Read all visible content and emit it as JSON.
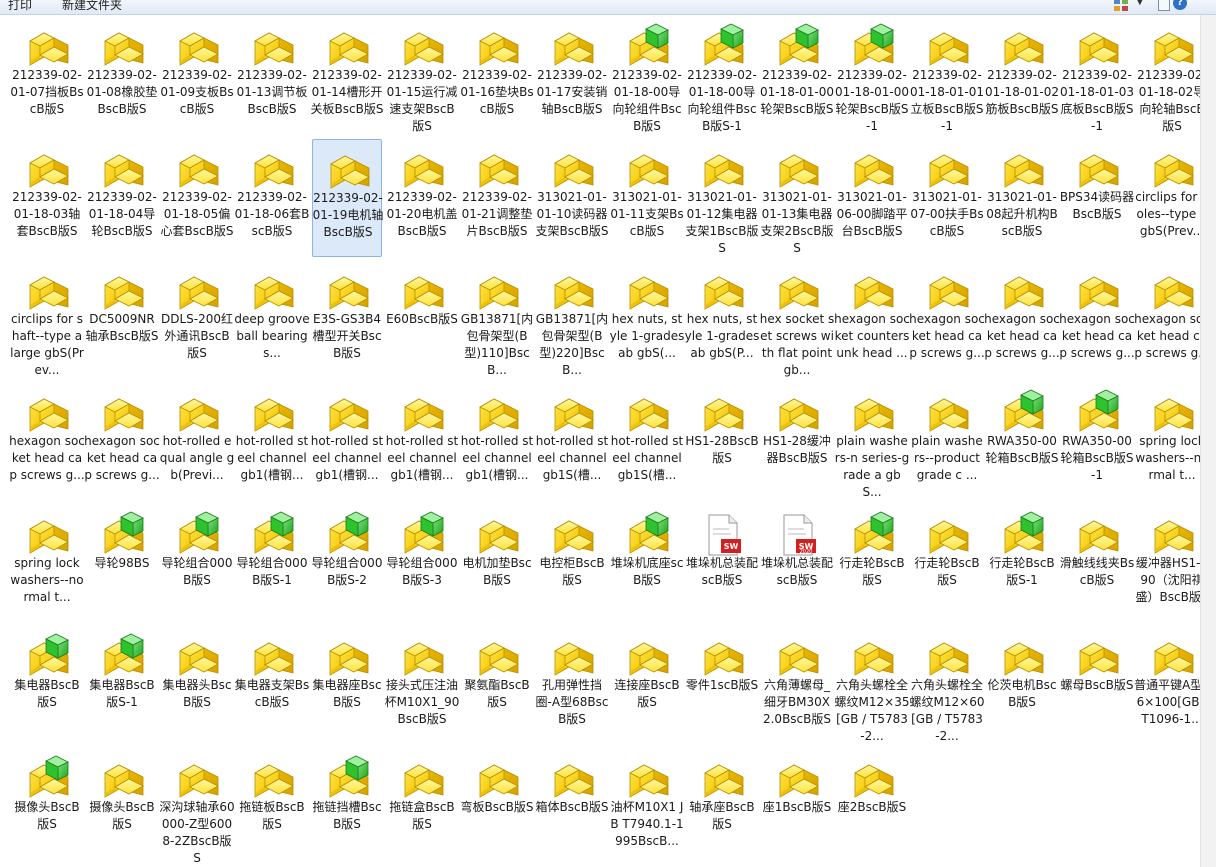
{
  "toolbar": {
    "print_label": "打印",
    "new_folder_label": "新建文件夹",
    "help_label": "?"
  },
  "files": [
    {
      "label": "212339-02-01-07挡板BscB版S",
      "icon": "solidworks-part-icon"
    },
    {
      "label": "212339-02-01-08橡胶垫BscB版S",
      "icon": "solidworks-part-icon"
    },
    {
      "label": "212339-02-01-09支板BscB版S",
      "icon": "solidworks-part-icon"
    },
    {
      "label": "212339-02-01-13调节板BscB版S",
      "icon": "solidworks-part-icon"
    },
    {
      "label": "212339-02-01-14槽形开关板BscB版S",
      "icon": "solidworks-part-icon"
    },
    {
      "label": "212339-02-01-15运行减速支架BscB版S",
      "icon": "solidworks-part-icon"
    },
    {
      "label": "212339-02-01-16垫块BscB版S",
      "icon": "solidworks-part-icon"
    },
    {
      "label": "212339-02-01-17安装销轴BscB版S",
      "icon": "solidworks-part-icon"
    },
    {
      "label": "212339-02-01-18-00导向轮组件BscB版S",
      "icon": "solidworks-assembly-icon"
    },
    {
      "label": "212339-02-01-18-00导向轮组件BscB版S-1",
      "icon": "solidworks-assembly-icon"
    },
    {
      "label": "212339-02-01-18-01-00轮架BscB版S",
      "icon": "solidworks-assembly-icon"
    },
    {
      "label": "212339-02-01-18-01-00轮架BscB版S-1",
      "icon": "solidworks-assembly-icon"
    },
    {
      "label": "212339-02-01-18-01-01立板BscB版S-1",
      "icon": "solidworks-part-icon"
    },
    {
      "label": "212339-02-01-18-01-02筋板BscB版S",
      "icon": "solidworks-part-icon"
    },
    {
      "label": "212339-02-01-18-01-03底板BscB版S-1",
      "icon": "solidworks-part-icon"
    },
    {
      "label": "212339-02-01-18-02导向轮轴BscB版S",
      "icon": "solidworks-part-icon"
    },
    {
      "label": "212339-02-01-18-03轴套BscB版S",
      "icon": "solidworks-part-icon"
    },
    {
      "label": "212339-02-01-18-04导轮BscB版S",
      "icon": "solidworks-part-icon"
    },
    {
      "label": "212339-02-01-18-05偏心套BscB版S",
      "icon": "solidworks-part-icon"
    },
    {
      "label": "212339-02-01-18-06套BscB版S",
      "icon": "solidworks-part-icon"
    },
    {
      "label": "212339-02-01-19电机轴BscB版S",
      "icon": "solidworks-part-icon",
      "selected": true
    },
    {
      "label": "212339-02-01-20电机盖BscB版S",
      "icon": "solidworks-part-icon"
    },
    {
      "label": "212339-02-01-21调整垫片BscB版S",
      "icon": "solidworks-part-icon"
    },
    {
      "label": "313021-01-01-10读码器支架BscB版S",
      "icon": "solidworks-part-icon"
    },
    {
      "label": "313021-01-01-11支架BscB版S",
      "icon": "solidworks-part-icon"
    },
    {
      "label": "313021-01-01-12集电器支架1BscB版S",
      "icon": "solidworks-part-icon"
    },
    {
      "label": "313021-01-01-13集电器支架2BscB版S",
      "icon": "solidworks-part-icon"
    },
    {
      "label": "313021-01-06-00脚踏平台BscB版S",
      "icon": "solidworks-part-icon"
    },
    {
      "label": "313021-01-07-00扶手BscB版S",
      "icon": "solidworks-part-icon"
    },
    {
      "label": "313021-01-08起升机构BscB版S",
      "icon": "solidworks-part-icon"
    },
    {
      "label": "BPS34读码器BscB版S",
      "icon": "solidworks-part-icon"
    },
    {
      "label": "circlips for holes--type a gbS(Prev...",
      "icon": "solidworks-part-icon"
    },
    {
      "label": "circlips for shaft--type a large gbS(Prev...",
      "icon": "solidworks-part-icon"
    },
    {
      "label": "DC5009NR轴承BscB版S",
      "icon": "solidworks-part-icon"
    },
    {
      "label": "DDLS-200红外通讯BscB版S",
      "icon": "solidworks-part-icon"
    },
    {
      "label": "deep groove ball bearings...",
      "icon": "solidworks-part-icon"
    },
    {
      "label": "E3S-GS3B4槽型开关BscB版S",
      "icon": "solidworks-part-icon"
    },
    {
      "label": "E60BscB版S",
      "icon": "solidworks-part-icon"
    },
    {
      "label": "GB13871[内包骨架型(B型)110]BscB...",
      "icon": "solidworks-part-icon"
    },
    {
      "label": "GB13871[内包骨架型(B型)220]BscB...",
      "icon": "solidworks-part-icon"
    },
    {
      "label": "hex nuts, style 1-grades ab gbS(...",
      "icon": "solidworks-part-icon"
    },
    {
      "label": "hex nuts, style 1-grades ab gbS(P...",
      "icon": "solidworks-part-icon"
    },
    {
      "label": "hex socket set screws with flat point gb...",
      "icon": "solidworks-part-icon"
    },
    {
      "label": "hexagon socket countersunk head ...",
      "icon": "solidworks-part-icon"
    },
    {
      "label": "hexagon socket head cap screws g...",
      "icon": "solidworks-part-icon"
    },
    {
      "label": "hexagon socket head cap screws g...",
      "icon": "solidworks-part-icon"
    },
    {
      "label": "hexagon socket head cap screws g...",
      "icon": "solidworks-part-icon"
    },
    {
      "label": "hexagon socket head cap screws g...",
      "icon": "solidworks-part-icon"
    },
    {
      "label": "hexagon socket head cap screws g...",
      "icon": "solidworks-part-icon"
    },
    {
      "label": "hexagon socket head cap screws g...",
      "icon": "solidworks-part-icon"
    },
    {
      "label": "hot-rolled equal angle gb(Previ...",
      "icon": "solidworks-part-icon"
    },
    {
      "label": "hot-rolled steel channel gb1(槽钢...",
      "icon": "solidworks-part-icon"
    },
    {
      "label": "hot-rolled steel channel gb1(槽钢...",
      "icon": "solidworks-part-icon"
    },
    {
      "label": "hot-rolled steel channel gb1(槽钢...",
      "icon": "solidworks-part-icon"
    },
    {
      "label": "hot-rolled steel channel gb1(槽钢...",
      "icon": "solidworks-part-icon"
    },
    {
      "label": "hot-rolled steel channel gb1S(槽...",
      "icon": "solidworks-part-icon"
    },
    {
      "label": "hot-rolled steel channel gb1S(槽...",
      "icon": "solidworks-part-icon"
    },
    {
      "label": "HS1-28BscB版S",
      "icon": "solidworks-part-icon"
    },
    {
      "label": "HS1-28缓冲器BscB版S",
      "icon": "solidworks-part-icon"
    },
    {
      "label": "plain washers-n series-grade a gbS...",
      "icon": "solidworks-part-icon"
    },
    {
      "label": "plain washers--product grade c ...",
      "icon": "solidworks-part-icon"
    },
    {
      "label": "RWA350-00轮箱BscB版S",
      "icon": "solidworks-assembly-icon"
    },
    {
      "label": "RWA350-00轮箱BscB版S-1",
      "icon": "solidworks-assembly-icon"
    },
    {
      "label": "spring lock washers--normal t...",
      "icon": "solidworks-part-icon"
    },
    {
      "label": "spring lock washers--normal t...",
      "icon": "solidworks-part-icon"
    },
    {
      "label": "导轮98BS",
      "icon": "solidworks-assembly-icon"
    },
    {
      "label": "导轮组合000B版S",
      "icon": "solidworks-assembly-icon"
    },
    {
      "label": "导轮组合000B版S-1",
      "icon": "solidworks-assembly-icon"
    },
    {
      "label": "导轮组合000B版S-2",
      "icon": "solidworks-assembly-icon"
    },
    {
      "label": "导轮组合000B版S-3",
      "icon": "solidworks-assembly-icon"
    },
    {
      "label": "电机加垫BscB版S",
      "icon": "solidworks-part-icon"
    },
    {
      "label": "电控柜BscB版S",
      "icon": "solidworks-part-icon"
    },
    {
      "label": "堆垛机底座scB版S",
      "icon": "solidworks-assembly-icon"
    },
    {
      "label": "堆垛机总装配scB版S",
      "icon": "solidworks-drawing-icon"
    },
    {
      "label": "堆垛机总装配scB版S",
      "icon": "solidworks-2020-drawing-icon"
    },
    {
      "label": "行走轮BscB版S",
      "icon": "solidworks-assembly-icon"
    },
    {
      "label": "行走轮BscB版S",
      "icon": "solidworks-part-icon"
    },
    {
      "label": "行走轮BscB版S-1",
      "icon": "solidworks-assembly-icon"
    },
    {
      "label": "滑触线线夹BscB版S",
      "icon": "solidworks-part-icon"
    },
    {
      "label": "缓冲器HS1-290（沈阳祺盛）BscB版S",
      "icon": "solidworks-part-icon"
    },
    {
      "label": "集电器BscB版S",
      "icon": "solidworks-assembly-icon"
    },
    {
      "label": "集电器BscB版S-1",
      "icon": "solidworks-assembly-icon"
    },
    {
      "label": "集电器头BscB版S",
      "icon": "solidworks-part-icon"
    },
    {
      "label": "集电器支架BscB版S",
      "icon": "solidworks-part-icon"
    },
    {
      "label": "集电器座BscB版S",
      "icon": "solidworks-part-icon"
    },
    {
      "label": "接头式压注油杯M10X1_90BscB版S",
      "icon": "solidworks-part-icon"
    },
    {
      "label": "聚氨酯BscB版S",
      "icon": "solidworks-part-icon"
    },
    {
      "label": "孔用弹性挡圈-A型68BscB版S",
      "icon": "solidworks-part-icon"
    },
    {
      "label": "连接座BscB版S",
      "icon": "solidworks-part-icon"
    },
    {
      "label": "零件1scB版S",
      "icon": "solidworks-part-icon"
    },
    {
      "label": "六角薄螺母_细牙BM30X2.0BscB版S",
      "icon": "solidworks-part-icon"
    },
    {
      "label": "六角头螺栓全螺纹M12×35[GB / T5783-2...",
      "icon": "solidworks-part-icon"
    },
    {
      "label": "六角头螺栓全螺纹M12×60[GB / T5783-2...",
      "icon": "solidworks-part-icon"
    },
    {
      "label": "伦茨电机BscB版S",
      "icon": "solidworks-part-icon"
    },
    {
      "label": "螺母BscB版S",
      "icon": "solidworks-part-icon"
    },
    {
      "label": "普通平键A型16×100[GB / T1096-1...",
      "icon": "solidworks-part-icon"
    },
    {
      "label": "摄像头BscB版S",
      "icon": "solidworks-assembly-icon"
    },
    {
      "label": "摄像头BscB版S",
      "icon": "solidworks-part-icon"
    },
    {
      "label": "深沟球轴承60000-Z型6008-2ZBscB版S",
      "icon": "solidworks-part-icon"
    },
    {
      "label": "拖链板BscB版S",
      "icon": "solidworks-part-icon"
    },
    {
      "label": "拖链挡槽BscB版S",
      "icon": "solidworks-assembly-icon"
    },
    {
      "label": "拖链盒BscB版S",
      "icon": "solidworks-part-icon"
    },
    {
      "label": "弯板BscB版S",
      "icon": "solidworks-part-icon"
    },
    {
      "label": "箱体BscB版S",
      "icon": "solidworks-part-icon"
    },
    {
      "label": "油杯M10X1 JB T7940.1-1995BscB...",
      "icon": "solidworks-part-icon"
    },
    {
      "label": "轴承座BscB版S",
      "icon": "solidworks-part-icon"
    },
    {
      "label": "座1BscB版S",
      "icon": "solidworks-part-icon"
    },
    {
      "label": "座2BscB版S",
      "icon": "solidworks-part-icon"
    }
  ]
}
